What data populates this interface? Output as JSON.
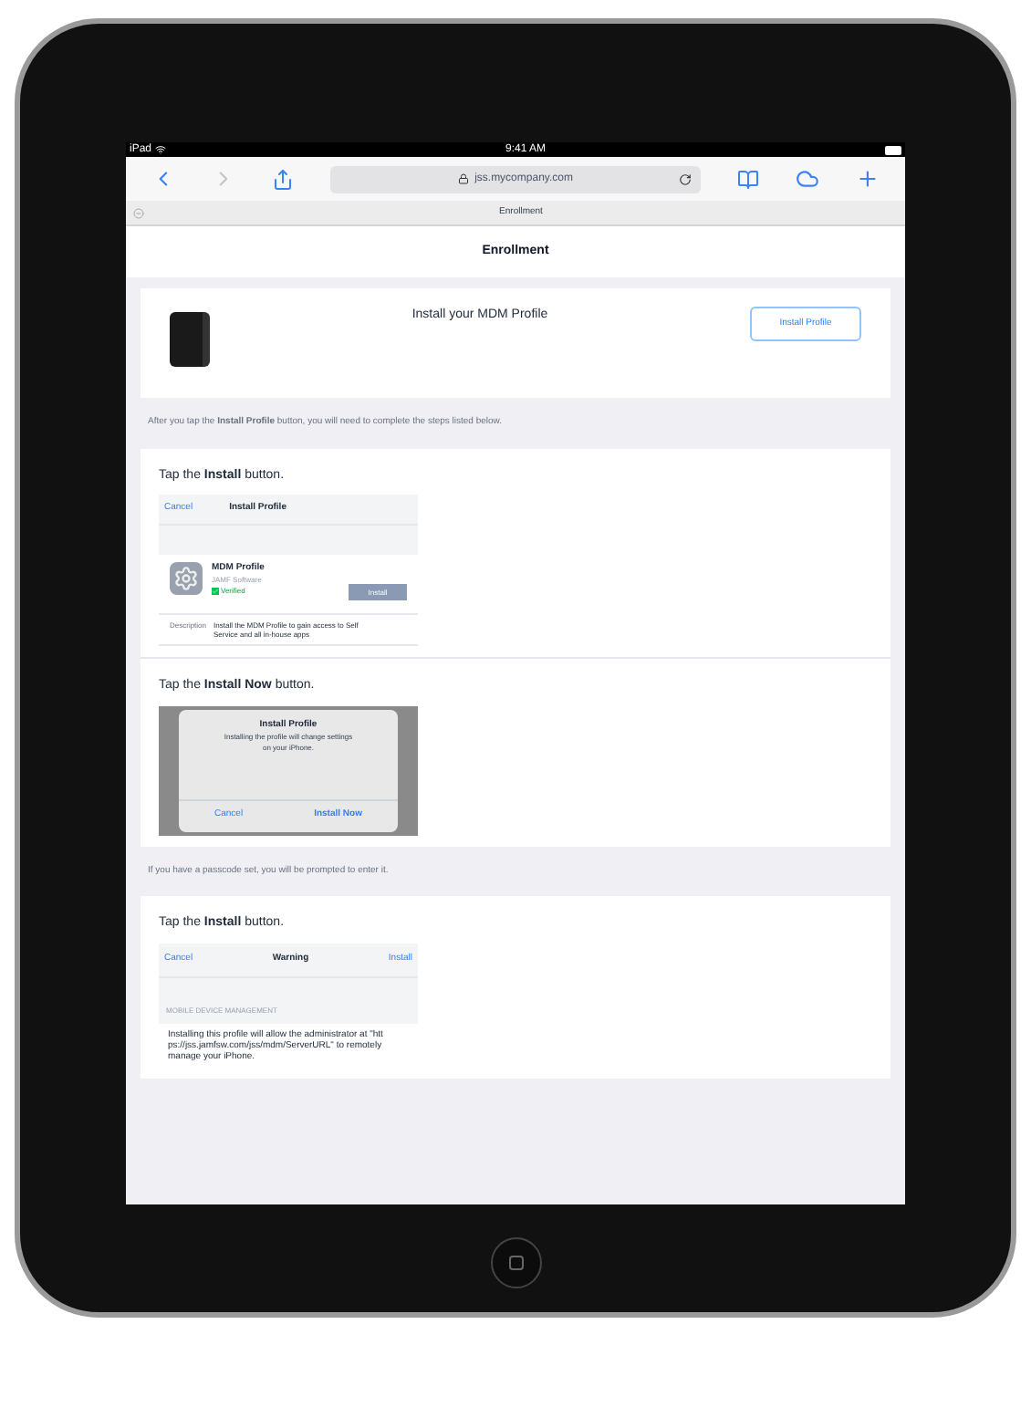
{
  "status_bar": {
    "carrier": "iPad",
    "time": "9:41 AM"
  },
  "browser": {
    "url": "jss.mycompany.com",
    "tab_title": "Enrollment"
  },
  "page": {
    "title": "Enrollment",
    "profile_card": {
      "heading": "Install your MDM Profile",
      "button": "Install Profile"
    },
    "sections": [
      {
        "kind": "note",
        "text": "After you tap the **Install Profile** button, you will need to complete the steps listed below."
      },
      {
        "kind": "card",
        "steps": [
          {
            "kind": "profile_sheet",
            "instruction": "Tap the **Install** button.",
            "cancel": "Cancel",
            "title": "Install Profile",
            "profile_name": "MDM Profile",
            "org": "JAMF Software",
            "verified": "Verified",
            "install": "Install",
            "description_label": "Description",
            "description": "Install the MDM Profile to gain access to Self Service and all in-house apps"
          },
          {
            "kind": "alert",
            "instruction": "Tap the **Install Now** button.",
            "title": "Install Profile",
            "message": "Installing the profile will change settings on your iPhone.",
            "cancel": "Cancel",
            "confirm": "Install Now"
          }
        ]
      },
      {
        "kind": "note",
        "text": "If you have a passcode set, you will be prompted to enter it."
      },
      {
        "kind": "card",
        "steps": [
          {
            "kind": "warning_sheet",
            "instruction": "Tap the **Install** button.",
            "cancel": "Cancel",
            "title": "Warning",
            "action": "Install",
            "section": "MOBILE DEVICE MANAGEMENT",
            "body": "Installing this profile will allow the administrator at \"https://jss.jamfsw.com/jss/mdm/ServerURL\" to remotely manage your iPhone."
          }
        ]
      }
    ]
  }
}
